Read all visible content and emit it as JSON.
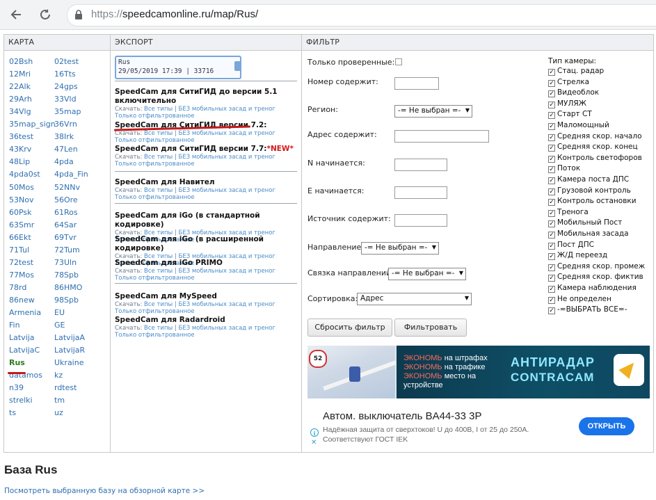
{
  "browser": {
    "url_proto": "https://",
    "url_rest": "speedcamonline.ru/map/Rus/"
  },
  "headers": {
    "map": "КАРТА",
    "export": "ЭКСПОРТ",
    "filter": "ФИЛЬТР"
  },
  "maps": {
    "left": [
      "02Bsh",
      "12Mri",
      "22Alk",
      "29Arh",
      "34Vlg",
      "35map_sign",
      "36test",
      "43Krv",
      "48Lip",
      "4pda0st",
      "50Mos",
      "53Nov",
      "60Psk",
      "63Smr",
      "66Ekt",
      "71Tul",
      "72test",
      "77Mos",
      "78rd",
      "86new",
      "Armenia",
      "Fin",
      "Latvija",
      "LatvijaC",
      "Rus",
      "datamos",
      "n39",
      "strelki",
      "ts"
    ],
    "right": [
      "02test",
      "16Tts",
      "24gps",
      "33Vld",
      "35map",
      "36Vrn",
      "38Irk",
      "47Len",
      "4pda",
      "4pda_Fin",
      "52NNv",
      "56Ore",
      "61Ros",
      "64Sar",
      "69Tvr",
      "72Tum",
      "73Uln",
      "78Spb",
      "86HMO",
      "98Spb",
      "EU",
      "GE",
      "LatvijaA",
      "LatvijaR",
      "Ukraine",
      "kz",
      "rdtest",
      "tm",
      "uz"
    ],
    "selected": "Rus"
  },
  "export": {
    "badge_line1": "Rus",
    "badge_line2": "29/05/2019 17:39 | 33716",
    "sub_download": "Скачать:",
    "sub_all": "Все типы",
    "sub_sep": " | ",
    "sub_nomobile": "БЕЗ мобильных засад и треног",
    "sub_filtered": "Только отфильтрованное",
    "items": [
      {
        "title": "SpeedCam для СитиГИД до версии 5.1 включительно"
      },
      {
        "title": "SpeedCam для СитиГИД версии 7.2:"
      },
      {
        "title": "SpeedCam для СитиГИД версии 7.7:",
        "new": "*NEW*"
      },
      {
        "title": "SpeedCam для Навител"
      },
      {
        "title": "SpeedCam для iGo (в стандартной кодировке)"
      },
      {
        "title": "SpeedCam для iGo (в расширенной кодировке)"
      },
      {
        "title": "SpeedCam для iGo PRIMO"
      },
      {
        "title": "SpeedCam для MySpeed"
      },
      {
        "title": "SpeedCam для Radardroid"
      }
    ]
  },
  "filter": {
    "only_verified": "Только проверенные:",
    "number_contains": "Номер содержит:",
    "region": "Регион:",
    "region_value": "-= Не выбран =-",
    "address_contains": "Адрес содержит:",
    "n_starts": "N начинается:",
    "e_starts": "E начинается:",
    "source_contains": "Источник содержит:",
    "direction": "Направление:",
    "direction_value": "-= Не выбран =-",
    "direction_link": "Связка направлений:",
    "direction_link_value": "-= Не выбран =-",
    "sort": "Сортировка:",
    "sort_value": "Адрес",
    "reset_button": "Сбросить фильтр",
    "apply_button": "Фильтровать",
    "cam_types_title": "Тип камеры:",
    "cam_types": [
      "Стац. радар",
      "Стрелка",
      "Видеоблок",
      "МУЛЯЖ",
      "Старт СТ",
      "Маломощный",
      "Средняя скор. начало",
      "Средняя скор. конец",
      "Контроль светофоров",
      "Поток",
      "Камера поста ДПС",
      "Грузовой контроль",
      "Контроль остановки",
      "Тренога",
      "Мобильный Пост",
      "Мобильная засада",
      "Пост ДПС",
      "Ж/Д переезд",
      "Средняя скор. промеж",
      "Средняя скор. фиктив",
      "Камера наблюдения",
      "Не определен",
      "-=ВЫБРАТЬ ВСЕ=-"
    ]
  },
  "ad1": {
    "speed": "52",
    "line1_a": "ЭКОНОМЬ",
    "line1_b": " на штрафах",
    "line2_a": "ЭКОНОМЬ",
    "line2_b": " на трафике",
    "line3_a": "ЭКОНОМЬ",
    "line3_b": " место на",
    "line4": "устройстве",
    "brand1": "АНТИРАДАР",
    "brand2": "CONTRACAM"
  },
  "ad2": {
    "title": "Автом. выключатель BA44-33 3P",
    "desc1": "Надёжная защита от сверхтоков! U до 400В, I от 25 до 250А.",
    "desc2": "Соответствуют ГОСТ IEK",
    "button": "ОТКРЫТЬ"
  },
  "base": {
    "title": "База Rus",
    "link": "Посмотреть выбранную базу на обзорной карте >>"
  }
}
